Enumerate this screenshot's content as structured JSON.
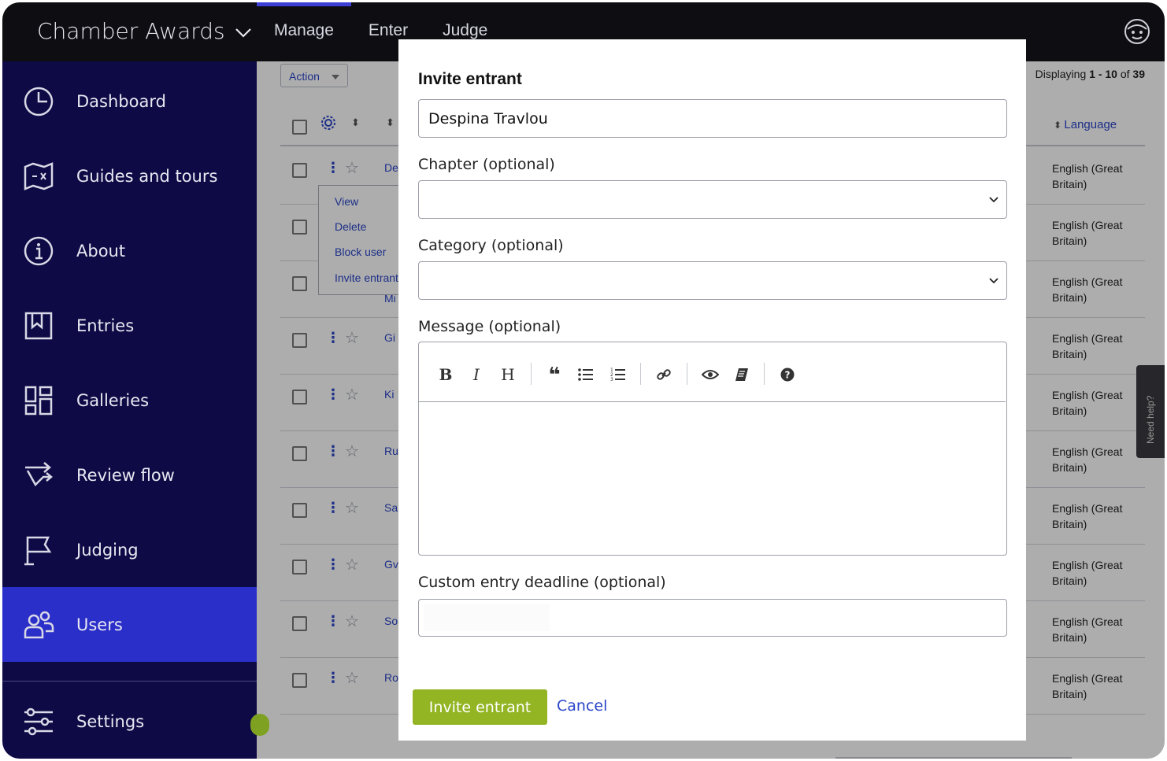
{
  "app": {
    "title": "Chamber Awards"
  },
  "topnav": [
    {
      "label": "Manage",
      "active": true
    },
    {
      "label": "Enter",
      "active": false
    },
    {
      "label": "Judge",
      "active": false
    }
  ],
  "sidebar": {
    "items": [
      {
        "label": "Dashboard",
        "icon": "dashboard-icon"
      },
      {
        "label": "Guides and tours",
        "icon": "map-icon"
      },
      {
        "label": "About",
        "icon": "info-icon"
      },
      {
        "label": "Entries",
        "icon": "bookmark-icon"
      },
      {
        "label": "Galleries",
        "icon": "gallery-icon"
      },
      {
        "label": "Review flow",
        "icon": "flow-icon"
      },
      {
        "label": "Judging",
        "icon": "flag-icon"
      },
      {
        "label": "Users",
        "icon": "users-icon",
        "active": true
      }
    ],
    "settings": {
      "label": "Settings",
      "icon": "sliders-icon"
    }
  },
  "table": {
    "action_label": "Action",
    "displaying": {
      "prefix": "Displaying ",
      "range": "1 - 10",
      "middle": " of ",
      "total": "39"
    },
    "language_header": "Language",
    "context_menu": [
      "View",
      "Delete",
      "Block user",
      "Invite entrant"
    ],
    "rows": [
      {
        "name": "De",
        "lang1": "English (Great",
        "lang2": "Britain)"
      },
      {
        "name": "",
        "lang1": "English (Great",
        "lang2": "Britain)"
      },
      {
        "name": "Mi",
        "lang1": "English (Great",
        "lang2": "Britain)"
      },
      {
        "name": "Gi",
        "lang1": "English (Great",
        "lang2": "Britain)"
      },
      {
        "name": "Ki",
        "lang1": "English (Great",
        "lang2": "Britain)"
      },
      {
        "name": "Ru",
        "lang1": "English (Great",
        "lang2": "Britain)"
      },
      {
        "name": "Sa",
        "lang1": "English (Great",
        "lang2": "Britain)"
      },
      {
        "name": "Gv",
        "lang1": "English (Great",
        "lang2": "Britain)"
      },
      {
        "name": "So",
        "lang1": "English (Great",
        "lang2": "Britain)"
      },
      {
        "name": "Ro",
        "lang1": "English (Great",
        "lang2": "Britain)"
      }
    ],
    "help_tab": "Need help?"
  },
  "modal": {
    "title": "Invite entrant",
    "name_value": "Despina Travlou",
    "chapter_label": "Chapter (optional)",
    "category_label": "Category (optional)",
    "message_label": "Message (optional)",
    "deadline_label": "Custom entry deadline (optional)",
    "submit_label": "Invite entrant",
    "cancel_label": "Cancel"
  },
  "colors": {
    "sidebar_bg": "#0e0a45",
    "sidebar_active": "#2b2fc9",
    "primary_button": "#93b523",
    "link": "#2a45c9"
  }
}
